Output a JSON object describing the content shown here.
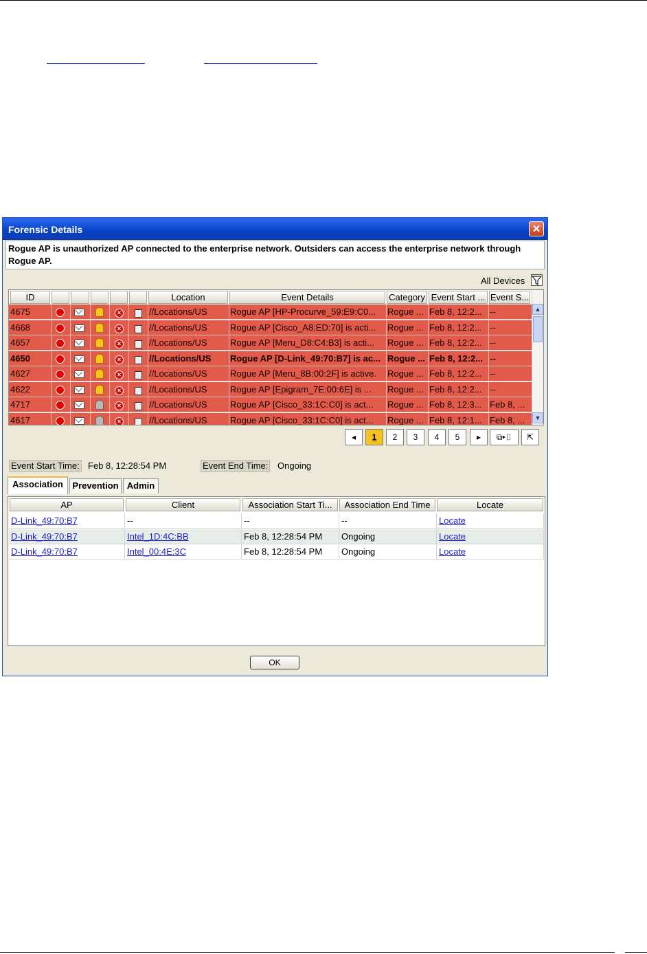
{
  "dialog": {
    "title": "Forensic Details",
    "description": "Rogue AP is unauthorized AP connected to the enterprise network. Outsiders can access the enterprise network through Rogue AP.",
    "filter_label": "All Devices",
    "columns": [
      "ID",
      "",
      "",
      "",
      "",
      "",
      "Location",
      "Event Details",
      "Category",
      "Event Start ...",
      "Event S..."
    ],
    "rows": [
      {
        "id": "4675",
        "location": "//Locations/US",
        "details": "Rogue AP [HP-Procurve_59:E9:C0...",
        "category": "Rogue ...",
        "start": "Feb 8, 12:2...",
        "end": "--",
        "bell": "yellow",
        "bold": false
      },
      {
        "id": "4668",
        "location": "//Locations/US",
        "details": "Rogue AP [Cisco_A8:ED:70] is acti...",
        "category": "Rogue ...",
        "start": "Feb 8, 12:2...",
        "end": "--",
        "bell": "yellow",
        "bold": false
      },
      {
        "id": "4657",
        "location": "//Locations/US",
        "details": "Rogue AP [Meru_D8:C4:B3] is acti...",
        "category": "Rogue ...",
        "start": "Feb 8, 12:2...",
        "end": "--",
        "bell": "yellow",
        "bold": false
      },
      {
        "id": "4650",
        "location": "//Locations/US",
        "details": "Rogue AP [D-Link_49:70:B7] is ac...",
        "category": "Rogue ...",
        "start": "Feb 8, 12:2...",
        "end": "--",
        "bell": "yellow",
        "bold": true
      },
      {
        "id": "4627",
        "location": "//Locations/US",
        "details": "Rogue AP [Meru_8B:00:2F] is active.",
        "category": "Rogue ...",
        "start": "Feb 8, 12:2...",
        "end": "--",
        "bell": "yellow",
        "bold": false
      },
      {
        "id": "4622",
        "location": "//Locations/US",
        "details": "Rogue AP [Epigram_7E:00:6E] is ...",
        "category": "Rogue ...",
        "start": "Feb 8, 12:2...",
        "end": "--",
        "bell": "yellow",
        "bold": false
      },
      {
        "id": "4717",
        "location": "//Locations/US",
        "details": "Rogue AP [Cisco_33:1C:C0] is act...",
        "category": "Rogue ...",
        "start": "Feb 8, 12:3...",
        "end": "Feb 8, ...",
        "bell": "grey",
        "bold": false
      },
      {
        "id": "4617",
        "location": "//Locations/US",
        "details": "Rogue AP [Cisco_33:1C:C0] is act...",
        "category": "Rogue ...",
        "start": "Feb 8, 12:1...",
        "end": "Feb 8, ...",
        "bell": "grey",
        "bold": false
      }
    ],
    "pages": [
      "1",
      "2",
      "3",
      "4",
      "5"
    ],
    "current_page": "1",
    "event_start_label": "Event Start Time:",
    "event_start_value": "Feb 8, 12:28:54 PM",
    "event_end_label": "Event End Time:",
    "event_end_value": "Ongoing",
    "tabs": [
      "Association",
      "Prevention",
      "Admin"
    ],
    "assoc_columns": [
      "AP",
      "Client",
      "Association Start Ti...",
      "Association End Time",
      "Locate"
    ],
    "assoc_rows": [
      {
        "ap": "D-Link_49:70:B7",
        "client": "--",
        "start": "--",
        "end": "--",
        "locate": "Locate"
      },
      {
        "ap": "D-Link_49:70:B7",
        "client": "Intel_1D:4C:BB",
        "start": "Feb 8, 12:28:54 PM",
        "end": "Ongoing",
        "locate": "Locate"
      },
      {
        "ap": "D-Link_49:70:B7",
        "client": "Intel_00:4E:3C",
        "start": "Feb 8, 12:28:54 PM",
        "end": "Ongoing",
        "locate": "Locate"
      }
    ],
    "ok_label": "OK"
  }
}
